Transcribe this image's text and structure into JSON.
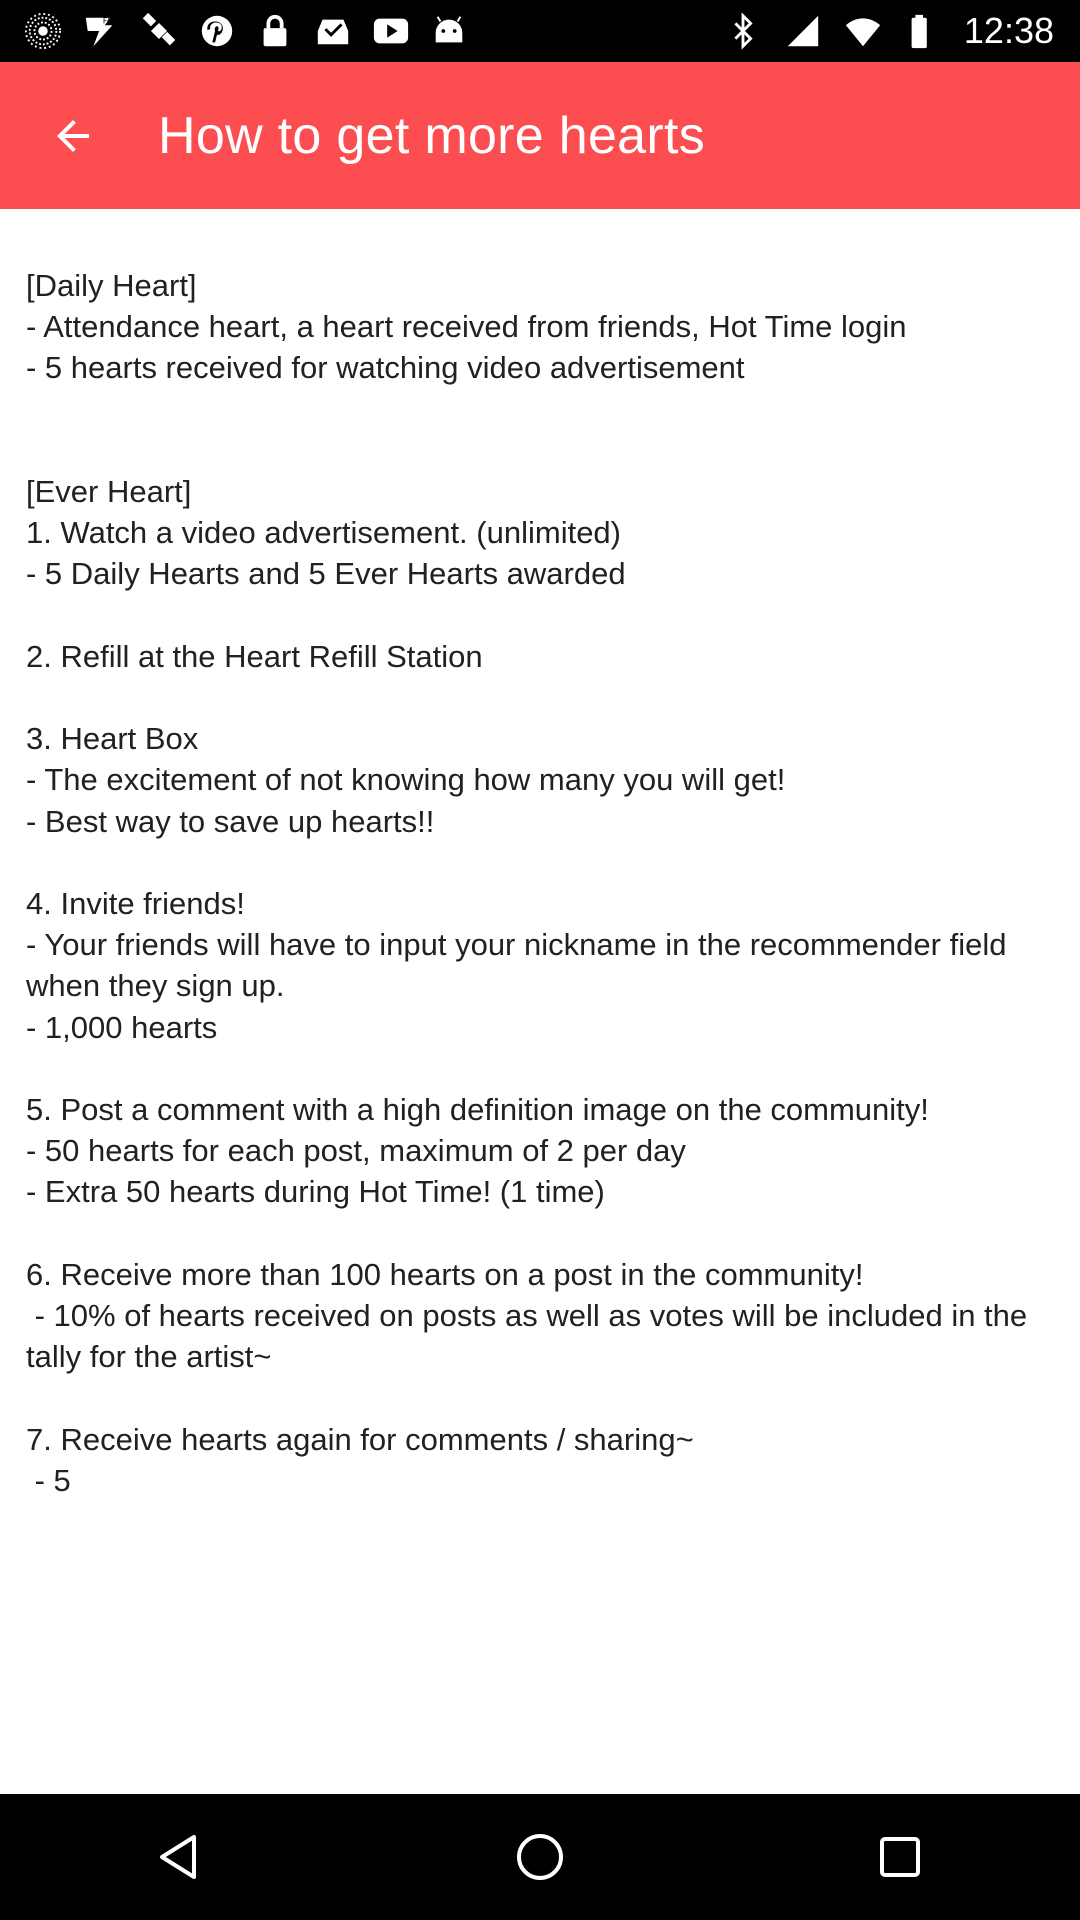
{
  "status_bar": {
    "time": "12:38",
    "left_icons": [
      "signal-burst-icon",
      "fake-gps-icon",
      "satellite-icon",
      "pinterest-icon",
      "lock-icon",
      "inbox-check-icon",
      "youtube-icon",
      "android-icon"
    ],
    "right_icons": [
      "bluetooth-icon",
      "cellular-icon",
      "wifi-icon",
      "battery-icon"
    ]
  },
  "app_bar": {
    "title": "How to get more hearts",
    "background_color": "#fc4e50"
  },
  "content": {
    "body": "[Daily Heart]\n- Attendance heart, a heart received from friends, Hot Time login\n- 5 hearts received for watching video advertisement\n\n\n[Ever Heart]\n1. Watch a video advertisement. (unlimited)\n- 5 Daily Hearts and 5 Ever Hearts awarded\n\n2. Refill at the Heart Refill Station\n\n3. Heart Box\n- The excitement of not knowing how many you will get!\n- Best way to save up hearts!!\n\n4. Invite friends!\n- Your friends will have to input your nickname in the recommender field when they sign up.\n- 1,000 hearts\n\n5. Post a comment with a high definition image on the community!\n- 50 hearts for each post, maximum of 2 per day\n- Extra 50 hearts during Hot Time! (1 time)\n\n6. Receive more than 100 hearts on a post in the community!\n - 10% of hearts received on posts as well as votes will be included in the tally for the artist~\n\n7. Receive hearts again for comments / sharing~\n - 5"
  },
  "nav_bar": {
    "buttons": [
      "back-triangle-icon",
      "home-circle-icon",
      "recents-square-icon"
    ]
  }
}
